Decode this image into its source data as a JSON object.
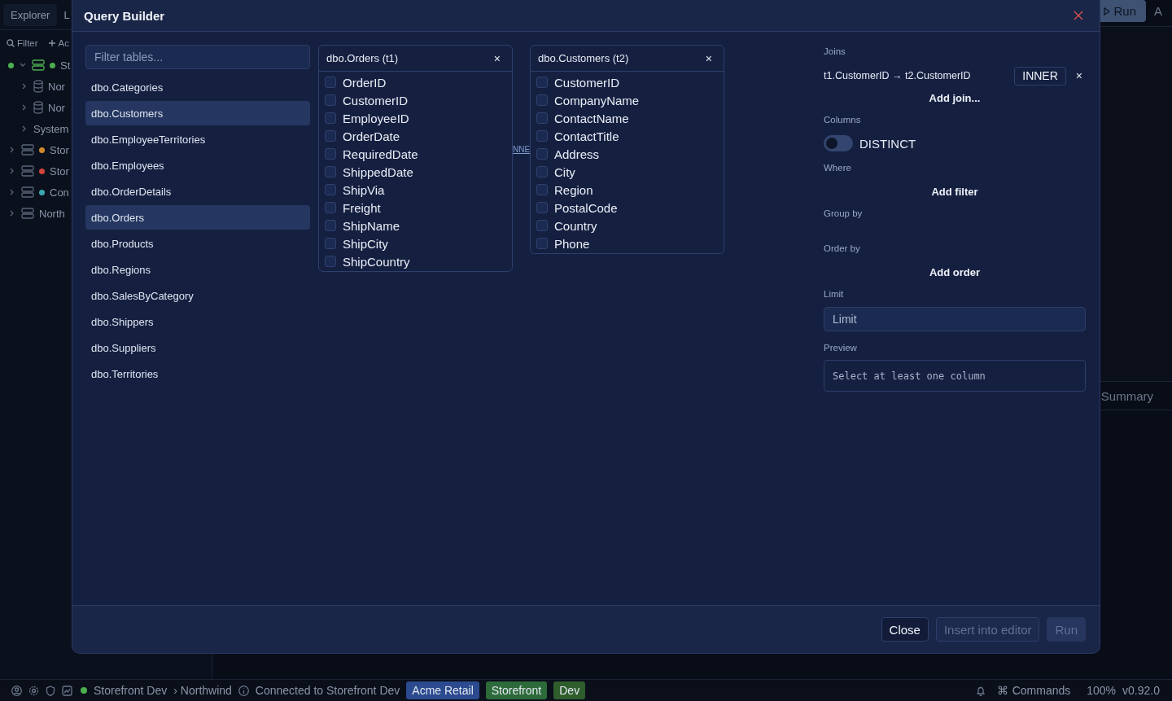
{
  "app": {
    "top_tabs": [
      {
        "label": "Explorer",
        "selected": true
      },
      {
        "label": "L",
        "selected": false
      }
    ],
    "toolbar": {
      "filter": "Filter",
      "add": "Ac"
    },
    "tree": [
      {
        "label": "St",
        "kind": "server",
        "color": "#4caf50",
        "expanded": true,
        "children": [
          {
            "label": "Nor",
            "kind": "database"
          },
          {
            "label": "Nor",
            "kind": "database"
          },
          {
            "label": "System",
            "kind": "folder"
          }
        ]
      },
      {
        "label": "Stor",
        "kind": "server",
        "color": "#d08a2c"
      },
      {
        "label": "Stor",
        "kind": "server",
        "color": "#d0463c"
      },
      {
        "label": "Con",
        "kind": "server",
        "color": "#3aa6b0"
      },
      {
        "label": "North",
        "kind": "server"
      }
    ],
    "run_button": "Run",
    "tab_partial": "A",
    "summary_tab": "Summary"
  },
  "modal": {
    "title": "Query Builder",
    "table_filter": {
      "placeholder": "Filter tables..."
    },
    "tables": [
      {
        "label": "dbo.Categories",
        "selected": false
      },
      {
        "label": "dbo.Customers",
        "selected": true
      },
      {
        "label": "dbo.EmployeeTerritories",
        "selected": false
      },
      {
        "label": "dbo.Employees",
        "selected": false
      },
      {
        "label": "dbo.OrderDetails",
        "selected": false
      },
      {
        "label": "dbo.Orders",
        "selected": true
      },
      {
        "label": "dbo.Products",
        "selected": false
      },
      {
        "label": "dbo.Regions",
        "selected": false
      },
      {
        "label": "dbo.SalesByCategory",
        "selected": false
      },
      {
        "label": "dbo.Shippers",
        "selected": false
      },
      {
        "label": "dbo.Suppliers",
        "selected": false
      },
      {
        "label": "dbo.Territories",
        "selected": false
      }
    ],
    "cards": [
      {
        "title": "dbo.Orders (t1)",
        "close": "×",
        "columns": [
          {
            "name": "OrderID",
            "checked": false
          },
          {
            "name": "CustomerID",
            "checked": false
          },
          {
            "name": "EmployeeID",
            "checked": false
          },
          {
            "name": "OrderDate",
            "checked": false
          },
          {
            "name": "RequiredDate",
            "checked": false
          },
          {
            "name": "ShippedDate",
            "checked": false
          },
          {
            "name": "ShipVia",
            "checked": false
          },
          {
            "name": "Freight",
            "checked": false
          },
          {
            "name": "ShipName",
            "checked": false
          },
          {
            "name": "ShipCity",
            "checked": false
          },
          {
            "name": "ShipCountry",
            "checked": false
          }
        ]
      },
      {
        "title": "dbo.Customers (t2)",
        "close": "×",
        "columns": [
          {
            "name": "CustomerID",
            "checked": false
          },
          {
            "name": "CompanyName",
            "checked": false
          },
          {
            "name": "ContactName",
            "checked": false
          },
          {
            "name": "ContactTitle",
            "checked": false
          },
          {
            "name": "Address",
            "checked": false
          },
          {
            "name": "City",
            "checked": false
          },
          {
            "name": "Region",
            "checked": false
          },
          {
            "name": "PostalCode",
            "checked": false
          },
          {
            "name": "Country",
            "checked": false
          },
          {
            "name": "Phone",
            "checked": false
          }
        ]
      }
    ],
    "join_link_label": "NNE",
    "panel": {
      "joins_label": "Joins",
      "joins": [
        {
          "text": "t1.CustomerID → t2.CustomerID",
          "type": "INNER",
          "remove": "×"
        }
      ],
      "add_join": "Add join...",
      "columns_label": "Columns",
      "distinct": {
        "label": "DISTINCT",
        "on": false
      },
      "where_label": "Where",
      "add_filter": "Add filter",
      "group_label": "Group by",
      "order_label": "Order by",
      "add_order": "Add order",
      "limit_label": "Limit",
      "limit": {
        "placeholder": "Limit"
      },
      "preview_label": "Preview",
      "preview": "Select at least one column"
    },
    "buttons": [
      {
        "label": "Close",
        "kind": "secondary",
        "disabled": false
      },
      {
        "label": "Insert into editor",
        "kind": "secondary",
        "disabled": true
      },
      {
        "label": "Run",
        "kind": "primary",
        "disabled": true
      }
    ]
  },
  "status_bar": {
    "connection": "Storefront Dev",
    "database": "› Northwind",
    "message": "Connected to Storefront Dev",
    "tags": [
      {
        "label": "Acme Retail",
        "color": "#2b4a8f"
      },
      {
        "label": "Storefront",
        "color": "#2d6a3a"
      },
      {
        "label": "Dev",
        "color": "#2f5d2c"
      }
    ],
    "commands_glyph": "⌘",
    "commands": "Commands",
    "zoom": "100%",
    "version": "v0.92.0"
  }
}
